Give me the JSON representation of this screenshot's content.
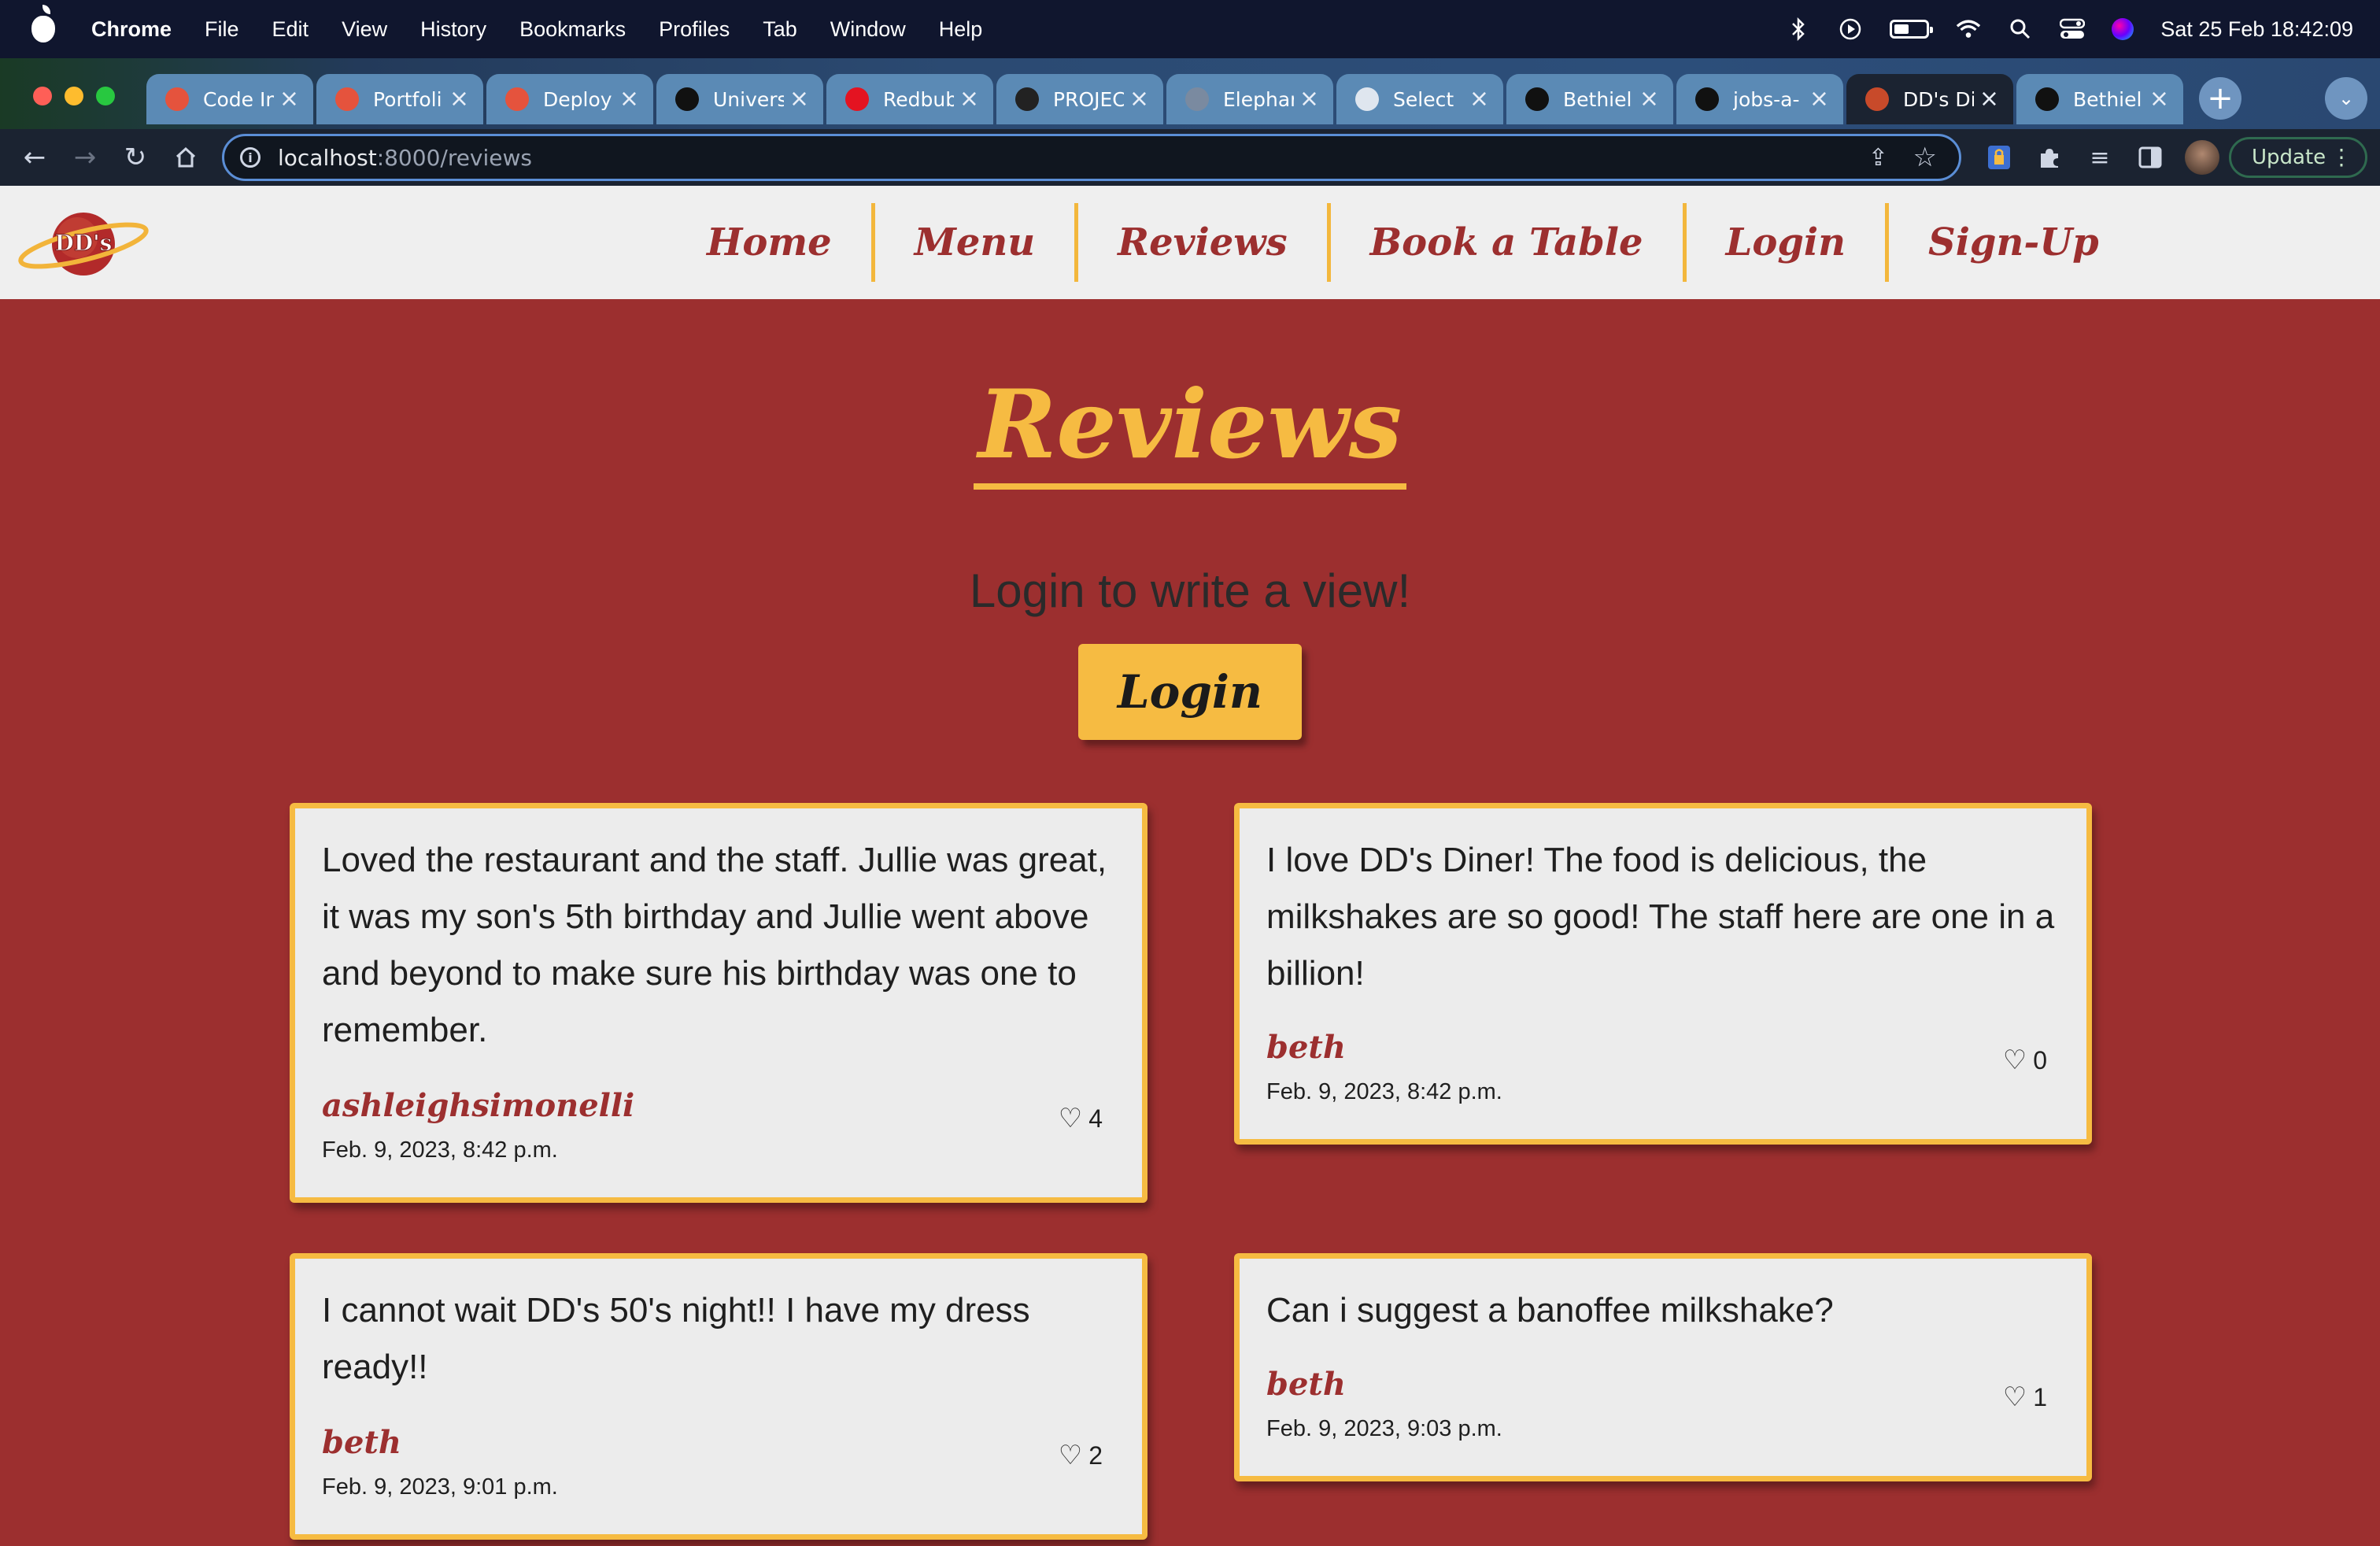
{
  "menubar": {
    "app": "Chrome",
    "items": [
      "File",
      "Edit",
      "View",
      "History",
      "Bookmarks",
      "Profiles",
      "Tab",
      "Window",
      "Help"
    ],
    "datetime": "Sat 25 Feb  18:42:09"
  },
  "tabs": [
    {
      "title": "Code In",
      "favicon": "code-institute-icon",
      "color": "#e5533d"
    },
    {
      "title": "Portfoli",
      "favicon": "code-institute-icon",
      "color": "#e5533d"
    },
    {
      "title": "Deploy",
      "favicon": "code-institute-icon",
      "color": "#e5533d"
    },
    {
      "title": "Univers",
      "favicon": "github-icon",
      "color": "#111111"
    },
    {
      "title": "Redbub",
      "favicon": "redbubble-icon",
      "color": "#e41321"
    },
    {
      "title": "PROJEC",
      "favicon": "project-icon",
      "color": "#222222"
    },
    {
      "title": "Elephar",
      "favicon": "elephant-icon",
      "color": "#7a8aa0"
    },
    {
      "title": "Select",
      "favicon": "globe-icon",
      "color": "#dfe6ef"
    },
    {
      "title": "Bethiel",
      "favicon": "github-icon",
      "color": "#111111"
    },
    {
      "title": "jobs-a-",
      "favicon": "github-icon",
      "color": "#111111"
    },
    {
      "title": "DD's Di",
      "favicon": "dds-logo-icon",
      "color": "#c84a2a",
      "active": true
    },
    {
      "title": "Bethiel",
      "favicon": "github-icon",
      "color": "#111111"
    }
  ],
  "toolbar": {
    "url_host": "localhost",
    "url_path": ":8000/reviews",
    "update_label": "Update"
  },
  "site": {
    "logo_text": "DD's",
    "nav": [
      "Home",
      "Menu",
      "Reviews",
      "Book a Table",
      "Login",
      "Sign-Up"
    ]
  },
  "page": {
    "title": "Reviews",
    "prompt": "Login to write a view!",
    "login_button": "Login"
  },
  "reviews": [
    {
      "text": "Loved the restaurant and the staff. Jullie was great, it was my son's 5th birthday and Jullie went above and beyond to make sure his birthday was one to remember.",
      "author": "ashleighsimonelli",
      "date": "Feb. 9, 2023, 8:42 p.m.",
      "likes": "4"
    },
    {
      "text": "I love DD's Diner! The food is delicious, the milkshakes are so good! The staff here are one in a billion!",
      "author": "beth",
      "date": "Feb. 9, 2023, 8:42 p.m.",
      "likes": "0"
    },
    {
      "text": "I cannot wait DD's 50's night!! I have my dress ready!!",
      "author": "beth",
      "date": "Feb. 9, 2023, 9:01 p.m.",
      "likes": "2"
    },
    {
      "text": "Can i suggest a banoffee milkshake?",
      "author": "beth",
      "date": "Feb. 9, 2023, 9:03 p.m.",
      "likes": "1"
    }
  ],
  "colors": {
    "page_bg": "#9c2f2f",
    "accent": "#f6bb42",
    "card_bg": "#ececec",
    "header_bg": "#efefef"
  }
}
